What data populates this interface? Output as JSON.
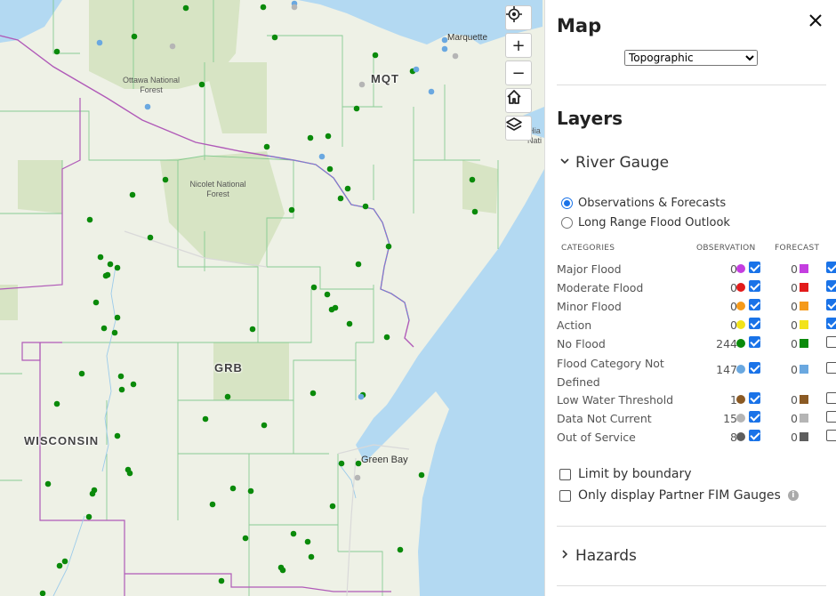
{
  "map": {
    "labels": {
      "ottawa": "Ottawa National Forest",
      "nicolet": "Nicolet National Forest",
      "hiawatha": "Hia Nati",
      "marquette": "Marquette",
      "green_bay": "Green Bay",
      "mqt": "MQT",
      "grb": "GRB",
      "wisconsin": "WISCONSIN"
    },
    "controls": {
      "locate_icon": "crosshair-icon",
      "zoom_in": "+",
      "zoom_out": "−",
      "home_icon": "home-icon",
      "layers_icon": "layers-icon"
    },
    "colors": {
      "water": "#b3d9f2",
      "land": "#eef1e6",
      "forest": "#d7e4c4",
      "county_line": "#7ec98c",
      "state_line": "#b05ab8",
      "gauge": "#0a8a0a"
    }
  },
  "panel": {
    "title": "Map",
    "basemap_selected": "Topographic",
    "layers_title": "Layers",
    "river_gauge": {
      "title": "River Gauge",
      "radios": [
        {
          "label": "Observations & Forecasts",
          "checked": true
        },
        {
          "label": "Long Range Flood Outlook",
          "checked": false
        }
      ],
      "headers": {
        "categories": "CATEGORIES",
        "observation": "OBSERVATION",
        "forecast": "FORECAST"
      },
      "categories": [
        {
          "name": "Major Flood",
          "obs": "0",
          "fc": "0",
          "color": "#c43ee0",
          "obs_checked": true,
          "fc_checked": true
        },
        {
          "name": "Moderate Flood",
          "obs": "0",
          "fc": "0",
          "color": "#e21b1b",
          "obs_checked": true,
          "fc_checked": true
        },
        {
          "name": "Minor Flood",
          "obs": "0",
          "fc": "0",
          "color": "#f59a1a",
          "obs_checked": true,
          "fc_checked": true
        },
        {
          "name": "Action",
          "obs": "0",
          "fc": "0",
          "color": "#f2e31a",
          "obs_checked": true,
          "fc_checked": true
        },
        {
          "name": "No Flood",
          "obs": "244",
          "fc": "0",
          "color": "#0a8a0a",
          "obs_checked": true,
          "fc_checked": false
        },
        {
          "name": "Flood Category Not Defined",
          "obs": "147",
          "fc": "0",
          "color": "#6aa8e0",
          "obs_checked": true,
          "fc_checked": false
        },
        {
          "name": "Low Water Threshold",
          "obs": "1",
          "fc": "0",
          "color": "#8b5a24",
          "obs_checked": true,
          "fc_checked": false
        },
        {
          "name": "Data Not Current",
          "obs": "15",
          "fc": "0",
          "color": "#b5b5b5",
          "obs_checked": true,
          "fc_checked": false
        },
        {
          "name": "Out of Service",
          "obs": "8",
          "fc": "0",
          "color": "#5e5e5e",
          "obs_checked": true,
          "fc_checked": false
        }
      ],
      "options": [
        {
          "label": "Limit by boundary",
          "checked": false
        },
        {
          "label": "Only display Partner FIM Gauges",
          "checked": false
        }
      ]
    },
    "hazards": {
      "title": "Hazards"
    }
  }
}
